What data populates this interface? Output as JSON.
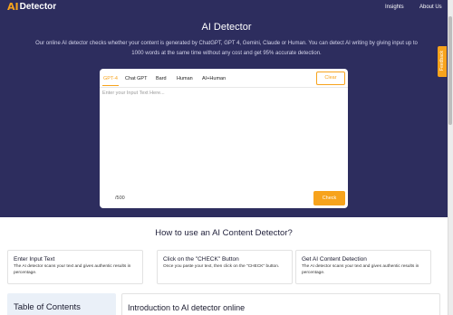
{
  "nav": {
    "logo_mark": "AI",
    "logo_text": "Detector",
    "links": [
      "Insights",
      "About Us"
    ]
  },
  "hero": {
    "title": "AI Detector",
    "description": "Our online AI detector checks whether your content is generated by ChatGPT, GPT 4, Gemini, Claude or Human. You can detect AI writing by giving input up to 1000 words at the same time without any cost and get 95% accurate detection."
  },
  "feedback_label": "Feedback",
  "detector": {
    "tabs": [
      "GPT-4",
      "Chat GPT",
      "Bard",
      "Human",
      "AI+Human"
    ],
    "active_tab": "GPT-4",
    "clear_label": "Clear",
    "input_placeholder": "Enter your Input Text Here...",
    "input_value": "",
    "word_counter": "/500",
    "check_label": "Check"
  },
  "howto": {
    "title": "How to use an AI Content Detector?",
    "cards": [
      {
        "title": "Enter Input Text",
        "text": "The AI detector scans your text and gives authentic results in percentage."
      },
      {
        "title": "Click on the \"CHECK\" Button",
        "text": "Once you paste your text, then click on the \"CHECK\" button."
      },
      {
        "title": "Get AI Content Detection",
        "text": "The AI detector scans your text and gives authentic results in percentage."
      }
    ]
  },
  "toc": {
    "title": "Table of Contents"
  },
  "intro": {
    "title": "Introduction to AI detector online"
  },
  "colors": {
    "hero_bg": "#2d2d5e",
    "accent": "#f7a31c"
  }
}
